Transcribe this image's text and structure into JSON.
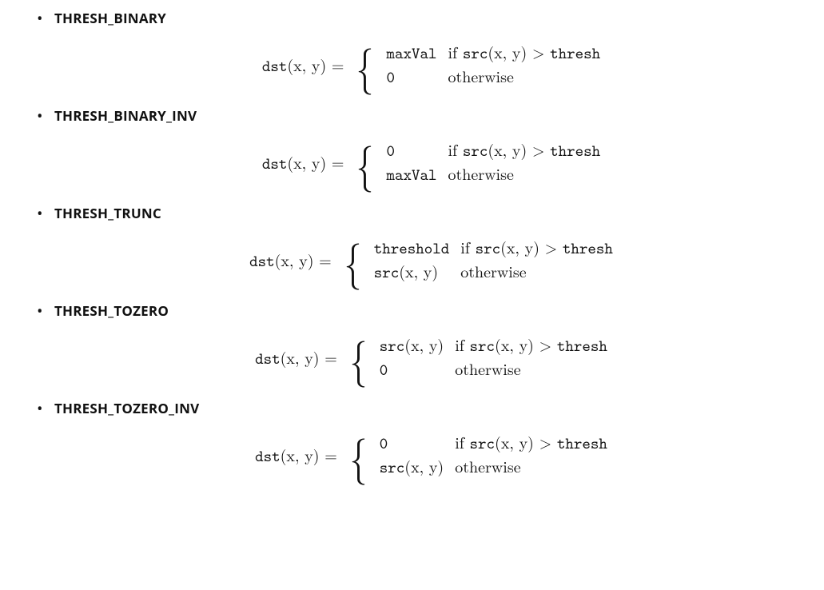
{
  "lhs": {
    "dst_txt": "dst",
    "args": "(x, y)",
    "equals": " = "
  },
  "cond": {
    "if": "if ",
    "src": "src",
    "args": "(x, y)",
    "gt": " > ",
    "thresh": "thresh",
    "otherwise": "otherwise"
  },
  "vals": {
    "maxVal": "maxVal",
    "zero": "0",
    "threshold": "threshold",
    "srcxy_src": "src",
    "srcxy_args": "(x, y)"
  },
  "items": [
    {
      "title": "THRESH_BINARY",
      "r0": "maxVal",
      "r1": "zero"
    },
    {
      "title": "THRESH_BINARY_INV",
      "r0": "zero",
      "r1": "maxVal"
    },
    {
      "title": "THRESH_TRUNC",
      "r0": "threshold",
      "r1": "srcxy"
    },
    {
      "title": "THRESH_TOZERO",
      "r0": "srcxy",
      "r1": "zero"
    },
    {
      "title": "THRESH_TOZERO_INV",
      "r0": "zero",
      "r1": "srcxy"
    }
  ]
}
